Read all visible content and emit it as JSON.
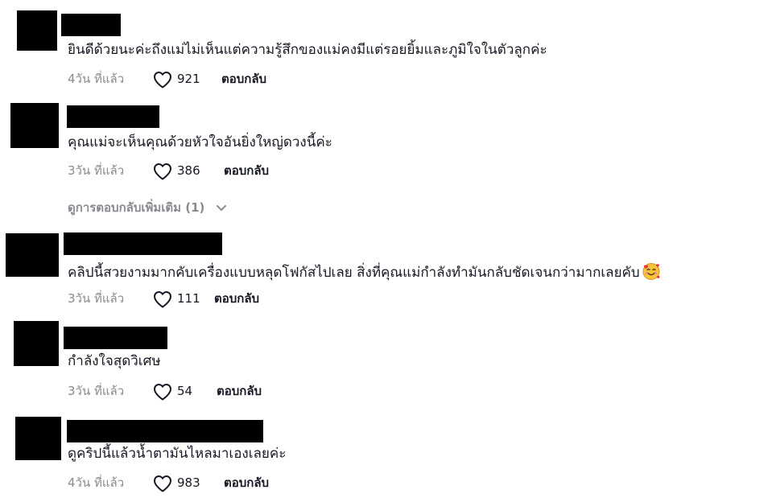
{
  "comments": [
    {
      "text": "ยินดีด้วยนะค่ะถึงแม่ไม่เห็นแต่ความรู้สึกของแม่คงมีแต่รอยยิ้มและภูมิใจในตัวลูกค่ะ",
      "time": "4วัน ที่แล้ว",
      "likes": "921",
      "reply_label": "ตอบกลับ"
    },
    {
      "text": "คุณแม่จะเห็นคุณด้วยหัวใจอันยิ่งใหญ่ดวงนี้ค่ะ",
      "time": "3วัน ที่แล้ว",
      "likes": "386",
      "reply_label": "ตอบกลับ"
    },
    {
      "text": "คลิปนี้สวยงามมากคับเครื่องแบบหลุดโฟกัสไปเลย สิ่งที่คุณแม่กำลังทำมันกลับชัดเจนกว่ามากเลยคับ",
      "time": "3วัน ที่แล้ว",
      "likes": "111",
      "reply_label": "ตอบกลับ"
    },
    {
      "text": "กำลังใจสุดวิเศษ",
      "time": "3วัน ที่แล้ว",
      "likes": "54",
      "reply_label": "ตอบกลับ"
    },
    {
      "text": "ดูคริปนี้แล้วน้ำตามันไหลมาเองเลยค่ะ",
      "time": "4วัน ที่แล้ว",
      "likes": "983",
      "reply_label": "ตอบกลับ"
    }
  ],
  "view_more_replies": "ดูการตอบกลับเพิ่มเติม (1)",
  "icons": {
    "like": "heart-outline-icon",
    "expand": "chevron-down-icon",
    "emoji": "smiling-face-with-hearts-emoji"
  },
  "colors": {
    "text": "#161823",
    "meta": "#8a8b91",
    "redaction": "#000000"
  }
}
